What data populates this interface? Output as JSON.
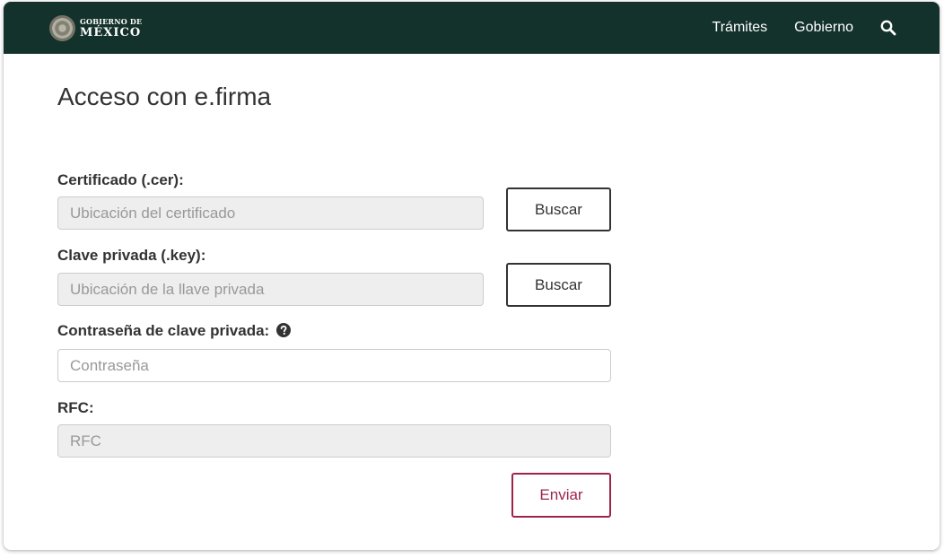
{
  "header": {
    "logo_line1": "GOBIERNO DE",
    "logo_line2": "MÉXICO",
    "nav": [
      "Trámites",
      "Gobierno"
    ],
    "search_icon": "search-icon",
    "bar_color": "#13322b"
  },
  "page": {
    "title": "Acceso con e.firma"
  },
  "form": {
    "certificate": {
      "label": "Certificado (.cer):",
      "placeholder": "Ubicación del certificado",
      "button": "Buscar"
    },
    "private_key": {
      "label": "Clave privada (.key):",
      "placeholder": "Ubicación de la llave privada",
      "button": "Buscar"
    },
    "password": {
      "label": "Contraseña de clave privada:",
      "placeholder": "Contraseña",
      "help_icon": "question-circle-icon"
    },
    "rfc": {
      "label": "RFC:",
      "placeholder": "RFC"
    },
    "submit": {
      "label": "Enviar",
      "color": "#9d2449"
    }
  }
}
